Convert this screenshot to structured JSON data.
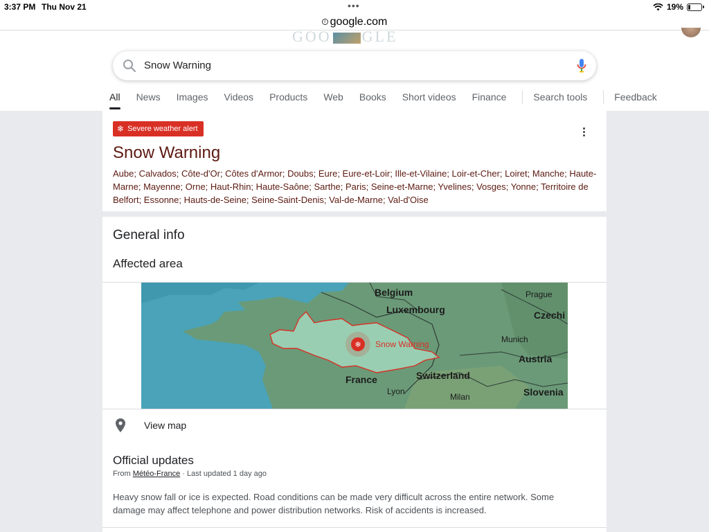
{
  "status_bar": {
    "time": "3:37 PM",
    "date": "Thu Nov 21",
    "battery": "19%",
    "battery_level": 0.19
  },
  "browser": {
    "url": "google.com"
  },
  "header": {
    "logo_text_left": "GOO",
    "logo_text_right": "GLE",
    "search_query": "Snow Warning",
    "tabs": [
      "All",
      "News",
      "Images",
      "Videos",
      "Products",
      "Web",
      "Books",
      "Short videos",
      "Finance"
    ],
    "search_tools": "Search tools",
    "feedback": "Feedback"
  },
  "alert": {
    "badge": "Severe weather alert",
    "title": "Snow Warning",
    "areas": "Aube; Calvados; Côte-d'Or; Côtes d'Armor; Doubs; Eure; Eure-et-Loir; Ille-et-Vilaine; Loir-et-Cher; Loiret; Manche; Haute-Marne; Mayenne; Orne; Haut-Rhin; Haute-Saône; Sarthe; Paris; Seine-et-Marne; Yvelines; Vosges; Yonne; Territoire de Belfort; Essonne; Hauts-de-Seine; Seine-Saint-Denis; Val-de-Marne; Val-d'Oise"
  },
  "general_info": {
    "title": "General info",
    "affected_area": "Affected area",
    "map_labels": {
      "belgium": "Belgium",
      "luxembourg": "Luxembourg",
      "prague": "Prague",
      "czechia": "Czechi",
      "munich": "Munich",
      "austria": "Austria",
      "france": "France",
      "switzerland": "Switzerland",
      "lyon": "Lyon",
      "milan": "Milan",
      "slovenia": "Slovenia",
      "warning": "Snow Warning"
    },
    "view_map": "View map"
  },
  "official_updates": {
    "title": "Official updates",
    "from_prefix": "From ",
    "source": "Météo-France",
    "updated": " · Last updated 1 day ago",
    "body": "Heavy snow fall or ice is expected. Road conditions can be made very difficult across the entire network. Some damage may affect telephone and power distribution networks. Risk of accidents is increased."
  },
  "colors": {
    "alert_red": "#d93025",
    "alert_text": "#5c1a11",
    "map_land": "#6b9a78",
    "map_sea": "#4aa3b8"
  }
}
